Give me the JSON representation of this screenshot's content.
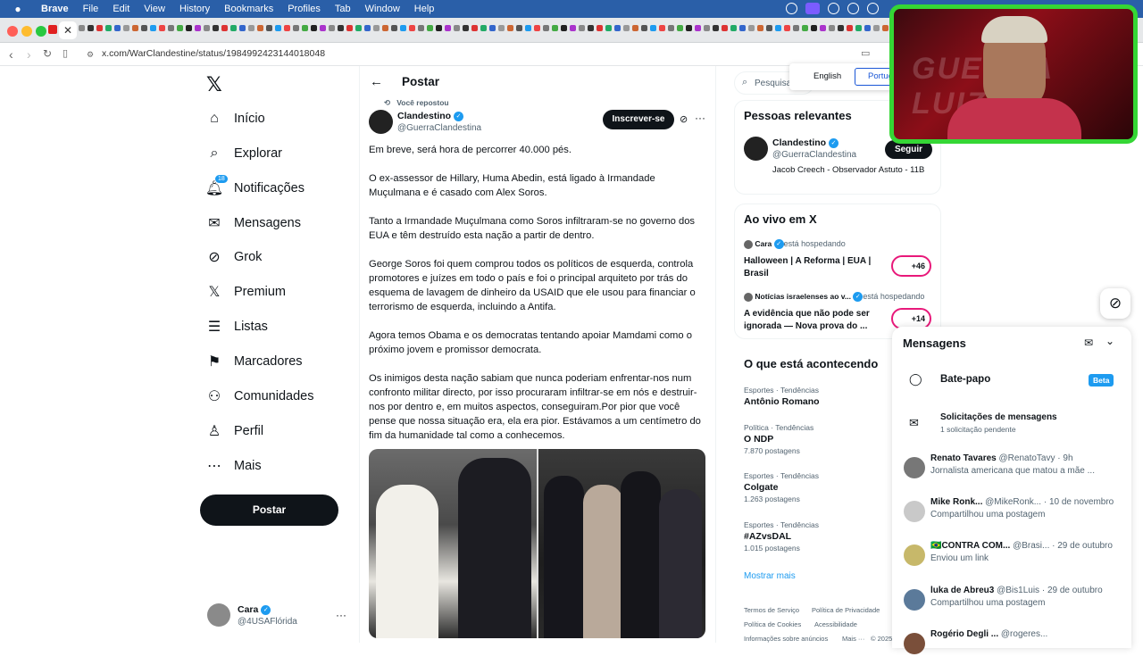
{
  "menubar": {
    "app": "Brave",
    "items": [
      "File",
      "Edit",
      "View",
      "History",
      "Bookmarks",
      "Profiles",
      "Tab",
      "Window",
      "Help"
    ]
  },
  "browser": {
    "url": "x.com/WarClandestine/status/1984992423144018048"
  },
  "nav": {
    "items": [
      {
        "label": "Início",
        "icon": "home-icon"
      },
      {
        "label": "Explorar",
        "icon": "search-icon"
      },
      {
        "label": "Notificações",
        "icon": "bell-icon",
        "badge": "18"
      },
      {
        "label": "Mensagens",
        "icon": "mail-icon"
      },
      {
        "label": "Grok",
        "icon": "grok-icon"
      },
      {
        "label": "Premium",
        "icon": "x-logo-icon"
      },
      {
        "label": "Listas",
        "icon": "list-icon"
      },
      {
        "label": "Marcadores",
        "icon": "bookmark-icon"
      },
      {
        "label": "Comunidades",
        "icon": "people-icon"
      },
      {
        "label": "Perfil",
        "icon": "person-icon"
      },
      {
        "label": "Mais",
        "icon": "more-circle-icon"
      }
    ],
    "post_button": "Postar",
    "account": {
      "name": "Cara",
      "handle": "@4USAFlórida"
    }
  },
  "header": {
    "title": "Postar"
  },
  "tweet": {
    "repost_label": "Você repostou",
    "author_name": "Clandestino",
    "author_handle": "@GuerraClandestina",
    "subscribe_label": "Inscrever-se",
    "paragraphs": [
      "Em breve, será hora de percorrer 40.000 pés.",
      "O ex-assessor de Hillary, Huma Abedin, está ligado à Irmandade Muçulmana e é casado com Alex Soros.",
      "Tanto a Irmandade Muçulmana como Soros infiltraram-se no governo dos EUA e têm destruído esta nação a partir de dentro.",
      "George Soros foi quem comprou todos os políticos de esquerda, controla promotores e juízes em todo o país e foi o principal arquiteto por trás do esquema de lavagem de dinheiro da USAID que ele usou para financiar o terrorismo de esquerda, incluindo a Antifa.",
      "Agora temos Obama e os democratas tentando apoiar Mamdami como o próximo jovem e promissor democrata.",
      "Os inimigos desta nação sabiam que nunca poderiam enfrentar-nos num confronto militar directo, por isso procuraram infiltrar-se em nós e destruir-nos por dentro e, em muitos aspectos, conseguiram.Por pior que você pense que nossa situação era, ela era pior. Estávamos a um centímetro do fim da humanidade tal como a conhecemos."
    ]
  },
  "search": {
    "placeholder": "Pesquisar"
  },
  "lang_popup": {
    "english": "English",
    "portuguese": "Português"
  },
  "relevant": {
    "title": "Pessoas relevantes",
    "name": "Clandestino",
    "handle": "@GuerraClandestina",
    "follow_label": "Seguir",
    "bio": "Jacob Creech - Observador Astuto - 11B"
  },
  "live": {
    "title": "Ao vivo em X",
    "items": [
      {
        "host": "Cara",
        "status": "está hospedando",
        "title": "Halloween | A Reforma | EUA | Brasil",
        "count": "+46"
      },
      {
        "host": "Notícias israelenses ao v...",
        "status": "está hospedando",
        "title": "A evidência que não pode ser ignorada — Nova prova do ...",
        "count": "+14"
      }
    ]
  },
  "trends": {
    "title": "O que está acontecendo",
    "items": [
      {
        "category": "Esportes · Tendências",
        "name": "Antônio Romano",
        "posts": ""
      },
      {
        "category": "Política · Tendências",
        "name": "O NDP",
        "posts": "7.870 postagens"
      },
      {
        "category": "Esportes · Tendências",
        "name": "Colgate",
        "posts": "1.263 postagens"
      },
      {
        "category": "Esportes · Tendências",
        "name": "#AZvsDAL",
        "posts": "1.015 postagens"
      }
    ],
    "show_more": "Mostrar mais"
  },
  "footer_links": [
    "Termos de Serviço",
    "Política de Privacidade",
    "Política de Cookies",
    "Acessibilidade",
    "Informações sobre anúncios",
    "Mais ···",
    "© 2025"
  ],
  "messages": {
    "title": "Mensagens",
    "chat_label": "Bate-papo",
    "beta": "Beta",
    "requests_title": "Solicitações de mensagens",
    "requests_sub": "1 solicitação pendente",
    "rows": [
      {
        "name": "Renato Tavares",
        "meta": "@RenatoTavy · 9h",
        "msg": "Jornalista americana que matou a mãe ..."
      },
      {
        "name": "Mike Ronk...",
        "meta": "@MikeRonk... · 10 de novembro",
        "msg": "Compartilhou uma postagem"
      },
      {
        "name": "🇧🇷CONTRA COM...",
        "meta": "@Brasi... · 29 de outubro",
        "msg": "Enviou um link"
      },
      {
        "name": "luka de Abreu3",
        "meta": "@Bis1Luis · 29 de outubro",
        "msg": "Compartilhou uma postagem"
      },
      {
        "name": "Rogério Degli ...",
        "meta": "@rogeres...",
        "msg": ""
      }
    ]
  },
  "webcam": {
    "backdrop_text": "GUERRA LUIZ"
  },
  "colors": {
    "accent": "#1d9bf0",
    "text": "#0f1419",
    "muted": "#536471",
    "webcam_border": "#35d635",
    "menubar": "#2a5fa8"
  }
}
